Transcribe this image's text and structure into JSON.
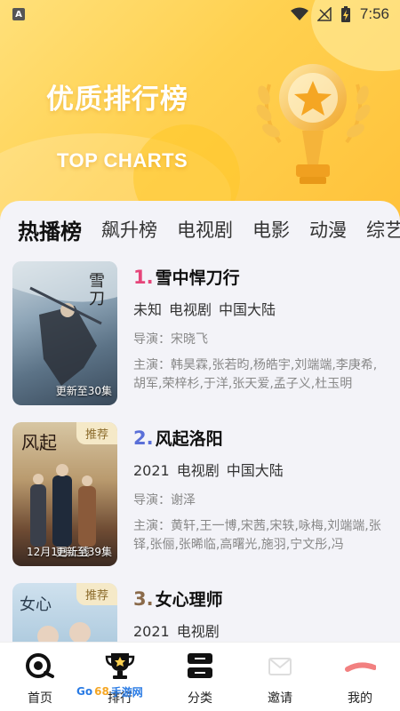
{
  "status_bar": {
    "time": "7:56",
    "left_icon": "A",
    "icons": [
      "wifi-icon",
      "no-signal-icon",
      "battery-charging-icon"
    ]
  },
  "banner": {
    "title": "优质排行榜",
    "subtitle": "TOP CHARTS",
    "icon": "trophy-icon"
  },
  "tabs": [
    {
      "label": "热播榜",
      "active": true
    },
    {
      "label": "飙升榜",
      "active": false
    },
    {
      "label": "电视剧",
      "active": false
    },
    {
      "label": "电影",
      "active": false
    },
    {
      "label": "动漫",
      "active": false
    },
    {
      "label": "综艺",
      "active": false
    }
  ],
  "items": [
    {
      "rank": "1.",
      "rank_color": "#e6457a",
      "title": "雪中悍刀行",
      "meta": [
        "未知",
        "电视剧",
        "中国大陆"
      ],
      "director": "导演：宋晓飞",
      "cast": "主演：韩昊霖,张若昀,杨皓宇,刘端端,李庚希,胡军,荣梓杉,于洋,张天爱,孟子义,杜玉明",
      "poster_update": "更新至30集",
      "poster_badge": "",
      "poster_date": ""
    },
    {
      "rank": "2.",
      "rank_color": "#5a6fd8",
      "title": "风起洛阳",
      "meta": [
        "2021",
        "电视剧",
        "中国大陆"
      ],
      "director": "导演：谢泽",
      "cast": "主演：黄轩,王一博,宋茜,宋轶,咏梅,刘端端,张铎,张俪,张晞临,高曙光,施羽,宁文彤,冯",
      "poster_update": "更新至39集",
      "poster_badge": "推荐",
      "poster_date": "12月1日上线"
    },
    {
      "rank": "3.",
      "rank_color": "#8a6a4a",
      "title": "女心理师",
      "meta": [
        "2021",
        "电视剧"
      ],
      "director": "",
      "cast": "",
      "poster_update": "",
      "poster_badge": "推荐",
      "poster_date": ""
    }
  ],
  "bottom_nav": [
    {
      "label": "首页",
      "icon": "home-icon"
    },
    {
      "label": "排行",
      "icon": "ranking-trophy-icon"
    },
    {
      "label": "分类",
      "icon": "category-icon"
    },
    {
      "label": "邀请",
      "icon": "invite-icon"
    },
    {
      "label": "我的",
      "icon": "profile-icon"
    }
  ],
  "watermark": {
    "left": "Go",
    "mid": "68",
    "right": "手游网"
  },
  "colors": {
    "banner": "#ffd150",
    "card_bg": "#f3f3f8"
  }
}
